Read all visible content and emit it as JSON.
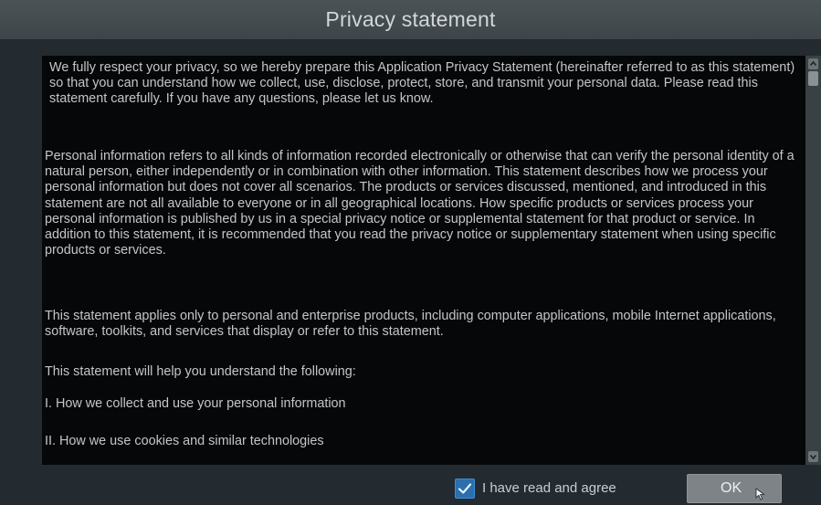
{
  "dialog": {
    "title": "Privacy statement"
  },
  "statement": {
    "paragraphs": [
      "We fully respect your privacy, so we hereby prepare this Application Privacy Statement (hereinafter referred to as this statement) so that you can understand how we collect, use, disclose, protect, store, and transmit your personal data. Please read this statement carefully. If you have any questions, please let us know.",
      "Personal information refers to all kinds of information recorded electronically or otherwise that can verify the personal identity of a natural person, either independently or in combination with other information. This statement describes how we process your personal information but does not cover all scenarios. The products or services discussed, mentioned, and introduced in this statement are not all available to everyone or in all geographical locations. How specific products or services process your personal information is published by us in a special privacy notice or supplemental statement for that product or service. In addition to this statement, it is recommended that you read the privacy notice or supplementary statement when using specific products or services.",
      "This statement applies only to personal and enterprise products, including computer applications, mobile Internet applications, software, toolkits, and services that display or refer to this statement.",
      "This statement will help you understand the following:",
      "I. How we collect and use your personal information",
      "II. How we use cookies and similar technologies"
    ]
  },
  "footer": {
    "agree_label": "I have read and agree",
    "agree_checked": true,
    "ok_label": "OK"
  },
  "icons": {
    "checkbox": "checkmark-icon",
    "scroll_up": "chevron-up-icon",
    "scroll_down": "chevron-down-icon",
    "cursor": "mouse-pointer-icon"
  },
  "colors": {
    "dialog_bg": "#242b30",
    "title_bg": "#4b5357",
    "content_bg": "#050708",
    "text": "#c3c7c9",
    "checkbox_accent": "#2a6fae",
    "button_bg": "#7d8387"
  }
}
